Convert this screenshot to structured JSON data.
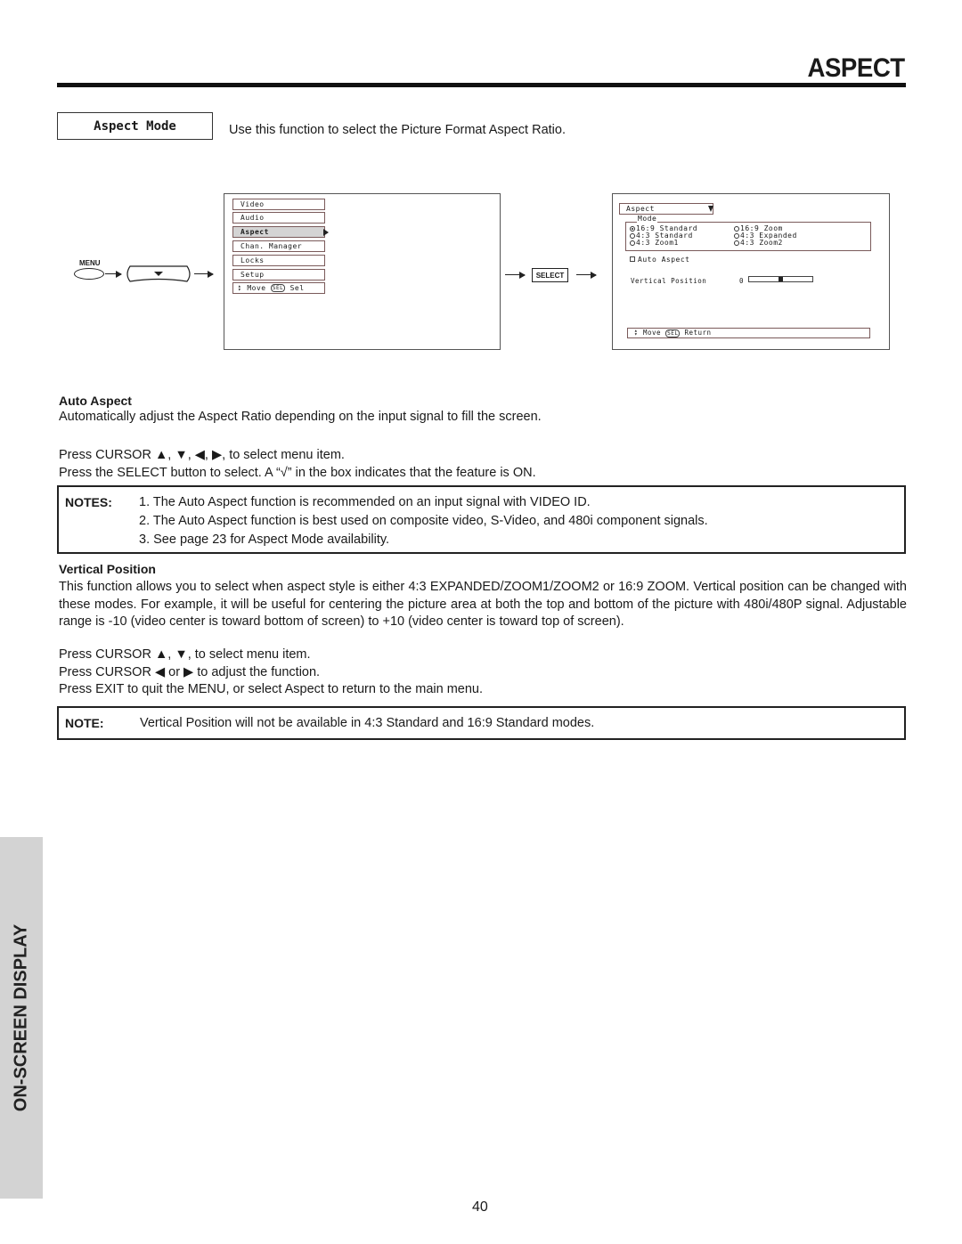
{
  "header": {
    "title": "ASPECT"
  },
  "aspect_mode": {
    "box_label": "Aspect Mode",
    "intro": "Use this function to select the Picture Format Aspect Ratio."
  },
  "remote": {
    "menu_label": "MENU",
    "select_label": "SELECT"
  },
  "main_menu": {
    "items": [
      "Video",
      "Audio",
      "Aspect",
      "Chan. Manager",
      "Locks",
      "Setup"
    ],
    "selected_index": 2,
    "help": {
      "move": "Move",
      "sel_badge": "SEL",
      "action": "Sel"
    }
  },
  "aspect_menu": {
    "dropdown_label": "Aspect",
    "mode_legend": "Mode",
    "modes": [
      {
        "label": "16:9 Standard",
        "selected": true
      },
      {
        "label": "16:9 Zoom",
        "selected": false
      },
      {
        "label": "4:3 Standard",
        "selected": false
      },
      {
        "label": "4:3 Expanded",
        "selected": false
      },
      {
        "label": "4:3 Zoom1",
        "selected": false
      },
      {
        "label": "4:3 Zoom2",
        "selected": false
      }
    ],
    "auto_aspect": {
      "label": "Auto Aspect",
      "checked": false
    },
    "vertical_position": {
      "label": "Vertical Position",
      "value": "0",
      "min": -10,
      "max": 10,
      "level": 0
    },
    "help": {
      "move": "Move",
      "sel_badge": "SEL",
      "action": "Return"
    }
  },
  "auto_aspect": {
    "heading": "Auto Aspect",
    "description": "Automatically adjust the Aspect Ratio depending on the input signal to fill the screen.",
    "instructions": [
      "Press CURSOR ▲, ▼, ◀, ▶, to select menu item.",
      "Press the SELECT button to select.  A “√” in the box indicates that the feature is ON."
    ]
  },
  "notes": {
    "label": "NOTES:",
    "items": [
      "1. The Auto Aspect function is recommended on an input signal with VIDEO ID.",
      "2. The Auto Aspect function is best used on composite video, S-Video, and 480i component signals.",
      "3. See page 23 for Aspect Mode availability."
    ]
  },
  "vertical_position": {
    "heading": "Vertical Position",
    "description": "This function allows you to select when aspect style is either 4:3 EXPANDED/ZOOM1/ZOOM2 or 16:9 ZOOM.  Vertical position can be changed with these modes.  For example, it will be useful for centering the picture area at both the top and bottom of the picture with 480i/480P signal.  Adjustable range is -10 (video center is toward bottom of screen) to +10 (video center is toward top of screen).",
    "instructions": [
      "Press CURSOR ▲, ▼, to select menu item.",
      "Press CURSOR  ◀ or ▶ to adjust the function.",
      "Press EXIT to quit the MENU, or select Aspect to return to the main menu."
    ]
  },
  "note": {
    "label": "NOTE:",
    "text": "Vertical Position will not be available in 4:3 Standard and 16:9 Standard modes."
  },
  "side_tab": {
    "label": "ON-SCREEN DISPLAY"
  },
  "page_number": "40"
}
